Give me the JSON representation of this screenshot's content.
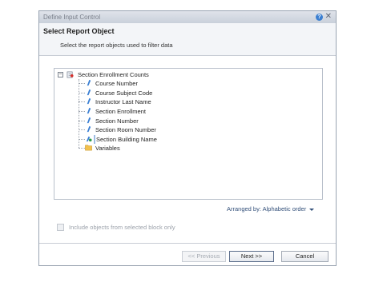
{
  "dialog": {
    "title": "Define Input Control",
    "header_title": "Select Report Object",
    "header_subtitle": "Select the report objects used to filter data"
  },
  "tree": {
    "root": {
      "label": "Section Enrollment Counts",
      "expander": "−",
      "icon": "report-query-icon"
    },
    "items": [
      {
        "label": "Course Number",
        "icon": "dimension-icon"
      },
      {
        "label": "Course Subject Code",
        "icon": "dimension-icon"
      },
      {
        "label": "Instructor Last Name",
        "icon": "dimension-icon"
      },
      {
        "label": "Section Enrollment",
        "icon": "dimension-icon"
      },
      {
        "label": "Section Number",
        "icon": "dimension-icon"
      },
      {
        "label": "Section Room Number",
        "icon": "dimension-icon"
      },
      {
        "label": "Section Building Name",
        "icon": "merged-dimension-icon",
        "selected": true
      },
      {
        "label": "Variables",
        "icon": "folder-icon"
      }
    ]
  },
  "arranged_by": "Arranged by: Alphabetic order",
  "include_block_only": {
    "label": "Include objects from selected block only",
    "checked": false,
    "enabled": false
  },
  "buttons": {
    "previous": "<< Previous",
    "next": "Next >>",
    "cancel": "Cancel"
  },
  "colors": {
    "selection": "#c8dcf3",
    "dimension_icon": "#3a7fd3",
    "folder_icon": "#f2c14e"
  }
}
